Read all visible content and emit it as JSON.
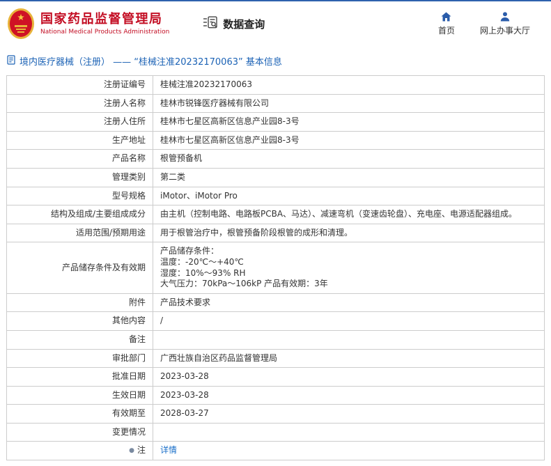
{
  "header": {
    "org_name": "国家药品监督管理局",
    "org_name_en": "National Medical Products Administration",
    "section_title": "数据查询",
    "nav": [
      {
        "label": "首页"
      },
      {
        "label": "网上办事大厅"
      }
    ]
  },
  "breadcrumb": {
    "text": "境内医疗器械（注册） —— “桂械注准20232170063” 基本信息"
  },
  "colors": {
    "brand_red": "#c30d23",
    "link_blue": "#1a6fc9",
    "nav_icon_blue": "#2a5caa"
  },
  "table": {
    "rows": [
      {
        "label": "注册证编号",
        "value": "桂械注准20232170063"
      },
      {
        "label": "注册人名称",
        "value": "桂林市锐锋医疗器械有限公司"
      },
      {
        "label": "注册人住所",
        "value": "桂林市七星区高新区信息产业园8-3号"
      },
      {
        "label": "生产地址",
        "value": "桂林市七星区高新区信息产业园8-3号"
      },
      {
        "label": "产品名称",
        "value": "根管预备机"
      },
      {
        "label": "管理类别",
        "value": "第二类"
      },
      {
        "label": "型号规格",
        "value": "iMotor、iMotor Pro"
      },
      {
        "label": "结构及组成/主要组成成分",
        "value": "由主机（控制电路、电路板PCBA、马达）、减速弯机（变速齿轮盘）、充电座、电源适配器组成。"
      },
      {
        "label": "适用范围/预期用途",
        "value": "用于根管治疗中，根管预备阶段根管的成形和清理。"
      },
      {
        "label": "产品储存条件及有效期",
        "value": "产品储存条件：\n温度：-20℃～+40℃\n湿度：10%～93% RH\n大气压力：70kPa～106kP 产品有效期：3年"
      },
      {
        "label": "附件",
        "value": "产品技术要求"
      },
      {
        "label": "其他内容",
        "value": "/"
      },
      {
        "label": "备注",
        "value": ""
      },
      {
        "label": "审批部门",
        "value": "广西壮族自治区药品监督管理局"
      },
      {
        "label": "批准日期",
        "value": "2023-03-28"
      },
      {
        "label": "生效日期",
        "value": "2023-03-28"
      },
      {
        "label": "有效期至",
        "value": "2028-03-27"
      },
      {
        "label": "变更情况",
        "value": ""
      },
      {
        "label": "注",
        "icon": "●",
        "value": "详情",
        "link": true
      }
    ]
  }
}
